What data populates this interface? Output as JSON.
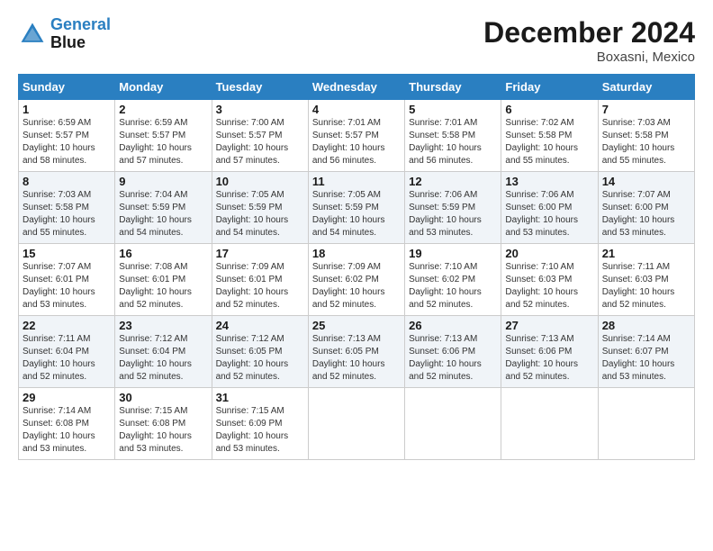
{
  "logo": {
    "line1": "General",
    "line2": "Blue"
  },
  "title": "December 2024",
  "location": "Boxasni, Mexico",
  "days_header": [
    "Sunday",
    "Monday",
    "Tuesday",
    "Wednesday",
    "Thursday",
    "Friday",
    "Saturday"
  ],
  "weeks": [
    [
      {
        "num": "1",
        "sunrise": "6:59 AM",
        "sunset": "5:57 PM",
        "daylight": "10 hours and 58 minutes."
      },
      {
        "num": "2",
        "sunrise": "6:59 AM",
        "sunset": "5:57 PM",
        "daylight": "10 hours and 57 minutes."
      },
      {
        "num": "3",
        "sunrise": "7:00 AM",
        "sunset": "5:57 PM",
        "daylight": "10 hours and 57 minutes."
      },
      {
        "num": "4",
        "sunrise": "7:01 AM",
        "sunset": "5:57 PM",
        "daylight": "10 hours and 56 minutes."
      },
      {
        "num": "5",
        "sunrise": "7:01 AM",
        "sunset": "5:58 PM",
        "daylight": "10 hours and 56 minutes."
      },
      {
        "num": "6",
        "sunrise": "7:02 AM",
        "sunset": "5:58 PM",
        "daylight": "10 hours and 55 minutes."
      },
      {
        "num": "7",
        "sunrise": "7:03 AM",
        "sunset": "5:58 PM",
        "daylight": "10 hours and 55 minutes."
      }
    ],
    [
      {
        "num": "8",
        "sunrise": "7:03 AM",
        "sunset": "5:58 PM",
        "daylight": "10 hours and 55 minutes."
      },
      {
        "num": "9",
        "sunrise": "7:04 AM",
        "sunset": "5:59 PM",
        "daylight": "10 hours and 54 minutes."
      },
      {
        "num": "10",
        "sunrise": "7:05 AM",
        "sunset": "5:59 PM",
        "daylight": "10 hours and 54 minutes."
      },
      {
        "num": "11",
        "sunrise": "7:05 AM",
        "sunset": "5:59 PM",
        "daylight": "10 hours and 54 minutes."
      },
      {
        "num": "12",
        "sunrise": "7:06 AM",
        "sunset": "5:59 PM",
        "daylight": "10 hours and 53 minutes."
      },
      {
        "num": "13",
        "sunrise": "7:06 AM",
        "sunset": "6:00 PM",
        "daylight": "10 hours and 53 minutes."
      },
      {
        "num": "14",
        "sunrise": "7:07 AM",
        "sunset": "6:00 PM",
        "daylight": "10 hours and 53 minutes."
      }
    ],
    [
      {
        "num": "15",
        "sunrise": "7:07 AM",
        "sunset": "6:01 PM",
        "daylight": "10 hours and 53 minutes."
      },
      {
        "num": "16",
        "sunrise": "7:08 AM",
        "sunset": "6:01 PM",
        "daylight": "10 hours and 52 minutes."
      },
      {
        "num": "17",
        "sunrise": "7:09 AM",
        "sunset": "6:01 PM",
        "daylight": "10 hours and 52 minutes."
      },
      {
        "num": "18",
        "sunrise": "7:09 AM",
        "sunset": "6:02 PM",
        "daylight": "10 hours and 52 minutes."
      },
      {
        "num": "19",
        "sunrise": "7:10 AM",
        "sunset": "6:02 PM",
        "daylight": "10 hours and 52 minutes."
      },
      {
        "num": "20",
        "sunrise": "7:10 AM",
        "sunset": "6:03 PM",
        "daylight": "10 hours and 52 minutes."
      },
      {
        "num": "21",
        "sunrise": "7:11 AM",
        "sunset": "6:03 PM",
        "daylight": "10 hours and 52 minutes."
      }
    ],
    [
      {
        "num": "22",
        "sunrise": "7:11 AM",
        "sunset": "6:04 PM",
        "daylight": "10 hours and 52 minutes."
      },
      {
        "num": "23",
        "sunrise": "7:12 AM",
        "sunset": "6:04 PM",
        "daylight": "10 hours and 52 minutes."
      },
      {
        "num": "24",
        "sunrise": "7:12 AM",
        "sunset": "6:05 PM",
        "daylight": "10 hours and 52 minutes."
      },
      {
        "num": "25",
        "sunrise": "7:13 AM",
        "sunset": "6:05 PM",
        "daylight": "10 hours and 52 minutes."
      },
      {
        "num": "26",
        "sunrise": "7:13 AM",
        "sunset": "6:06 PM",
        "daylight": "10 hours and 52 minutes."
      },
      {
        "num": "27",
        "sunrise": "7:13 AM",
        "sunset": "6:06 PM",
        "daylight": "10 hours and 52 minutes."
      },
      {
        "num": "28",
        "sunrise": "7:14 AM",
        "sunset": "6:07 PM",
        "daylight": "10 hours and 53 minutes."
      }
    ],
    [
      {
        "num": "29",
        "sunrise": "7:14 AM",
        "sunset": "6:08 PM",
        "daylight": "10 hours and 53 minutes."
      },
      {
        "num": "30",
        "sunrise": "7:15 AM",
        "sunset": "6:08 PM",
        "daylight": "10 hours and 53 minutes."
      },
      {
        "num": "31",
        "sunrise": "7:15 AM",
        "sunset": "6:09 PM",
        "daylight": "10 hours and 53 minutes."
      },
      null,
      null,
      null,
      null
    ]
  ]
}
